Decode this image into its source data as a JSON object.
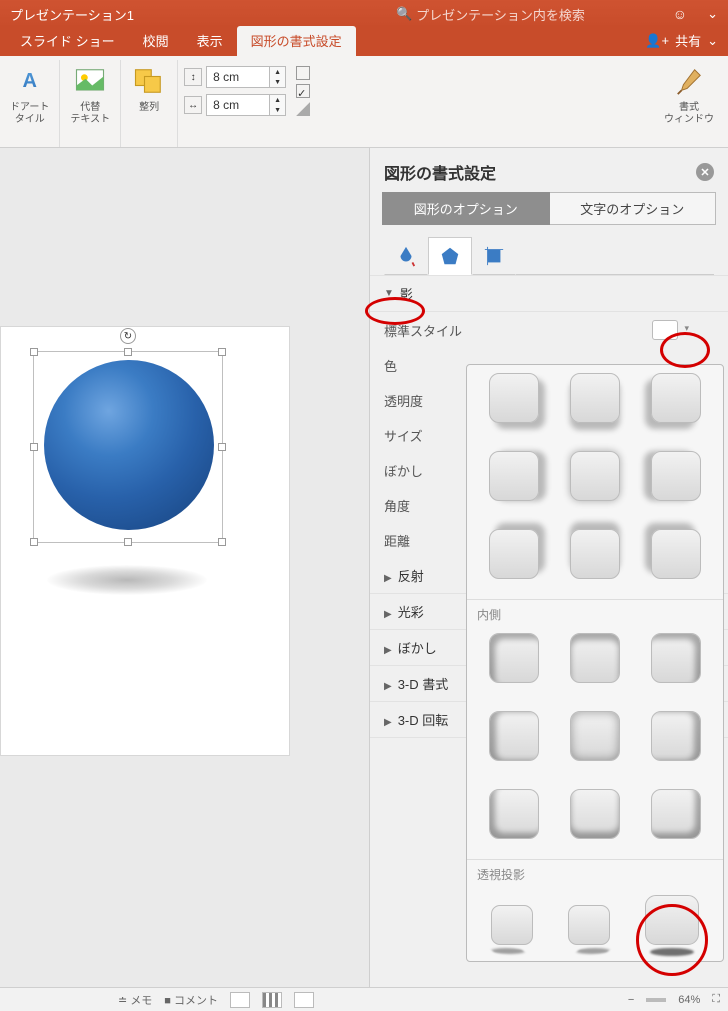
{
  "title": "プレゼンテーション1",
  "search_placeholder": "プレゼンテーション内を検索",
  "tabs": {
    "slideshow": "スライド ショー",
    "review": "校閲",
    "view": "表示",
    "format": "図形の書式設定"
  },
  "share": "共有",
  "ribbon": {
    "wordart": "ドアート\nタイル",
    "alttext": "代替\nテキスト",
    "arrange": "整列",
    "height": "8 cm",
    "width": "8 cm",
    "formatpane": "書式\nウィンドウ"
  },
  "pane": {
    "title": "図形の書式設定",
    "shape_opts": "図形のオプション",
    "text_opts": "文字のオプション",
    "sections": {
      "shadow": "影",
      "reflection": "反射",
      "glow": "光彩",
      "softedge": "ぼかし",
      "format3d": "3-D 書式",
      "rot3d": "3-D 回転"
    },
    "props": {
      "preset": "標準スタイル",
      "color": "色",
      "transparency": "透明度",
      "size": "サイズ",
      "blur": "ぼかし",
      "angle": "角度",
      "distance": "距離"
    }
  },
  "gallery": {
    "inner": "内側",
    "perspective": "透視投影"
  },
  "status": {
    "notes": "メモ",
    "comments": "コメント",
    "zoom": "64%"
  }
}
